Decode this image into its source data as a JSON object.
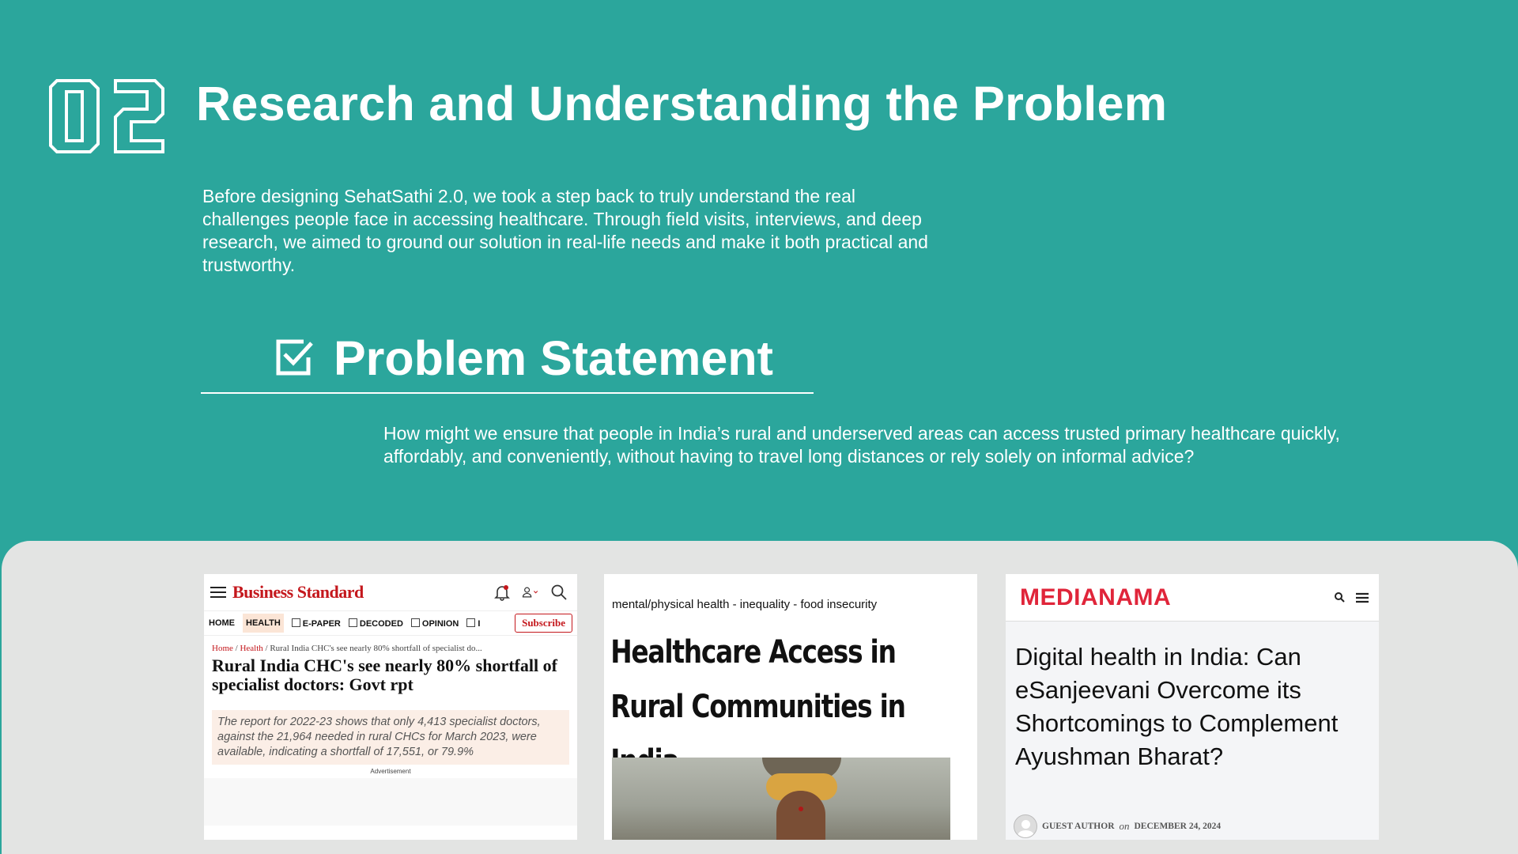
{
  "section": {
    "number": "02",
    "title": "Research and Understanding the Problem",
    "intro": "Before designing SehatSathi 2.0, we took a step back to truly understand the real challenges people face in accessing healthcare. Through field visits, interviews, and deep research, we aimed to ground our solution in real-life needs and make it both practical and trustworthy."
  },
  "problem": {
    "icon": "checkbox-icon",
    "title": "Problem Statement",
    "text": "How might we ensure that people in India’s rural and underserved areas can access trusted primary healthcare quickly, affordably, and conveniently, without having to travel long distances or rely solely on informal advice?"
  },
  "cards": {
    "business_standard": {
      "logo": "Business Standard",
      "nav": [
        "HOME",
        "HEALTH",
        "E-PAPER",
        "DECODED",
        "OPINION",
        "I"
      ],
      "subscribe": "Subscribe",
      "crumb_home": "Home",
      "crumb_section": "Health",
      "crumb_rest": " / Rural India CHC's see nearly 80% shortfall of specialist do...",
      "headline": "Rural India CHC's see nearly 80% shortfall of specialist doctors: Govt rpt",
      "quote": "The report for 2022-23 shows that only 4,413 specialist doctors, against the 21,964 needed in rural CHCs for March 2023, were available, indicating a shortfall of 17,551, or 79.9%",
      "ad": "Advertisement"
    },
    "healthcare_access": {
      "tags": "mental/physical health  -  inequality  -  food insecurity",
      "title": "Healthcare Access in Rural Communities in India"
    },
    "medianama": {
      "logo": "MEDIANAMA",
      "headline": "Digital health in India: Can eSanjeevani Overcome its Shortcomings to Complement Ayushman Bharat?",
      "author": "GUEST AUTHOR",
      "on": "on",
      "date": "DECEMBER 24, 2024"
    }
  },
  "colors": {
    "background": "#2ba69c",
    "gallery": "#e3e4e3",
    "bs_red": "#c4171c",
    "mn_red": "#e0253a"
  }
}
